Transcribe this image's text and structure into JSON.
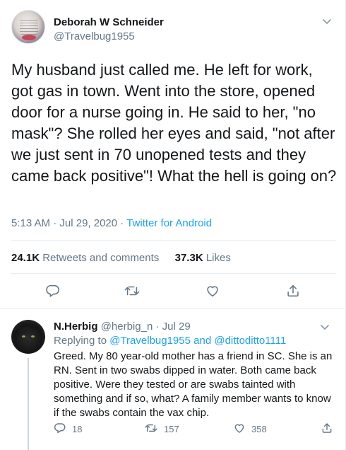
{
  "main_tweet": {
    "author_name": "Deborah W Schneider",
    "author_handle": "@Travelbug1955",
    "text": "My husband just called me. He left for work, got gas in town. Went into the store, opened door for a nurse going in. He said to her, \"no mask\"? She rolled her eyes and said, \"not after we just sent in 70 unopened tests and they came back positive\"! What the hell is going on?",
    "time": "5:13 AM",
    "date": "Jul 29, 2020",
    "separator": "·",
    "source": "Twitter for Android",
    "retweets_count": "24.1K",
    "retweets_label": "Retweets and comments",
    "likes_count": "37.3K",
    "likes_label": "Likes"
  },
  "reply": {
    "author_name": "N.Herbig",
    "author_handle": "@herbig_n",
    "separator": "·",
    "date": "Jul 29",
    "replying_prefix": "Replying to",
    "replying_user1": "@Travelbug1955",
    "replying_and": "and",
    "replying_user2": "@dittoditto1111",
    "text": "Greed. My 80 year-old mother has a friend in SC. She is an RN. Sent in two swabs dipped in water.  Both came back positive. Were they tested or are swabs tainted with something and if so, what?  A family member wants to know if the swabs contain the vax chip.",
    "reply_count": "18",
    "retweet_count": "157",
    "like_count": "358"
  },
  "icons": {
    "reply": "reply-icon",
    "retweet": "retweet-icon",
    "like": "heart-icon",
    "share": "share-icon",
    "menu": "chevron-down-icon"
  },
  "colors": {
    "accent": "#1da1f2",
    "muted": "#657786",
    "text": "#14171a",
    "divider": "#e6ecf0"
  }
}
